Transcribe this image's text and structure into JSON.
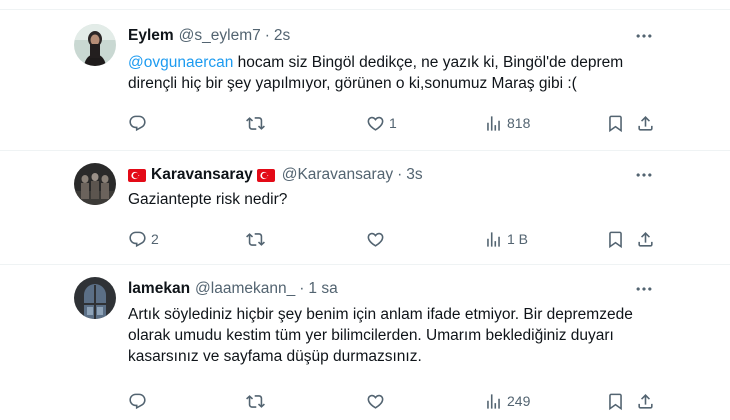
{
  "tweets": [
    {
      "author": "Eylem",
      "handle": "@s_eylem7",
      "separator": "·",
      "time": "2s",
      "text_mention": "@ovgunaercan",
      "text": " hocam siz Bingöl dedikçe, ne yazık ki, Bingöl'de deprem dirençli hiç bir şey yapılmıyor, görünen o ki,sonumuz Maraş gibi :(",
      "counts": {
        "replies": "",
        "retweets": "",
        "likes": "1",
        "views": "818"
      }
    },
    {
      "author": "Karavansaray",
      "handle": "@Karavansaray",
      "separator": "·",
      "time": "3s",
      "text": "Gaziantepte risk nedir?",
      "counts": {
        "replies": "2",
        "retweets": "",
        "likes": "",
        "views": "1 B"
      }
    },
    {
      "author": "lamekan",
      "handle": "@laamekann_",
      "separator": "·",
      "time": "1 sa",
      "text": "Artık söylediniz hiçbir şey benim için anlam ifade etmiyor. Bir depremzede olarak umudu kestim tüm yer bilimcilerden. Umarım beklediğiniz duyarı kasarsınız ve sayfama düşüp durmazsınız.",
      "counts": {
        "replies": "",
        "retweets": "",
        "likes": "",
        "views": "249"
      }
    }
  ],
  "icons": {
    "reply": "reply-icon",
    "retweet": "retweet-icon",
    "like": "like-icon",
    "views": "views-icon",
    "bookmark": "bookmark-icon",
    "share": "share-icon",
    "more": "more-icon",
    "flag": "turkey-flag-icon"
  },
  "colors": {
    "link": "#1d9bf0",
    "secondary_text": "#536471",
    "flag_red": "#e30a17",
    "divider": "#eff3f4"
  }
}
